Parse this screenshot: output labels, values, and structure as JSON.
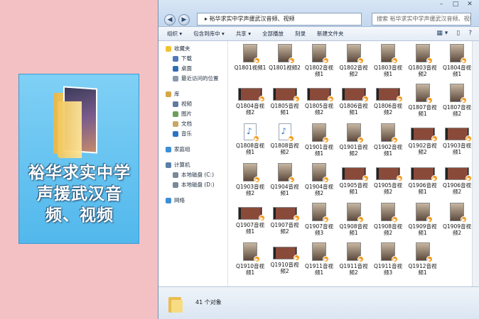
{
  "folder_tile": {
    "caption": "裕华求实中学声援武汉音频、视频"
  },
  "window": {
    "address": "裕华求实中学声援武汉音频、视频",
    "search_placeholder": "搜索 裕华求实中学声援武汉音频、视频",
    "controls": [
      "–",
      "□",
      "✕"
    ]
  },
  "toolbar": {
    "items": [
      "组织 ▾",
      "包含到库中 ▾",
      "共享 ▾",
      "全部播放",
      "刻录",
      "新建文件夹"
    ],
    "right_icons": [
      "▦ ▾",
      "▯",
      "?"
    ]
  },
  "sidebar": {
    "items": [
      {
        "label": "收藏夹",
        "icon": "star-icon",
        "color": "#f2c230",
        "sub": false
      },
      {
        "label": "下载",
        "icon": "download-icon",
        "color": "#4d79b8",
        "sub": true
      },
      {
        "label": "桌面",
        "icon": "desktop-icon",
        "color": "#2f6db2",
        "sub": true
      },
      {
        "label": "最近访问的位置",
        "icon": "recent-icon",
        "color": "#8a9bb0",
        "sub": true
      },
      {
        "label": "",
        "gap": true
      },
      {
        "label": "库",
        "icon": "library-icon",
        "color": "#d7a64a",
        "sub": false
      },
      {
        "label": "视频",
        "icon": "video-icon",
        "color": "#5f7aa0",
        "sub": true
      },
      {
        "label": "图片",
        "icon": "picture-icon",
        "color": "#6a9f5a",
        "sub": true
      },
      {
        "label": "文档",
        "icon": "document-icon",
        "color": "#c9a763",
        "sub": true
      },
      {
        "label": "音乐",
        "icon": "music-icon",
        "color": "#2a74c7",
        "sub": true
      },
      {
        "label": "",
        "gap": true
      },
      {
        "label": "家庭组",
        "icon": "homegroup-icon",
        "color": "#3d8fd6",
        "sub": false
      },
      {
        "label": "",
        "gap": true
      },
      {
        "label": "计算机",
        "icon": "computer-icon",
        "color": "#5a7fa8",
        "sub": false
      },
      {
        "label": "本地磁盘 (C:)",
        "icon": "drive-icon",
        "color": "#7b8899",
        "sub": true
      },
      {
        "label": "本地磁盘 (D:)",
        "icon": "drive-icon",
        "color": "#7b8899",
        "sub": true
      },
      {
        "label": "",
        "gap": true
      },
      {
        "label": "网络",
        "icon": "network-icon",
        "color": "#3d8fd6",
        "sub": false
      }
    ]
  },
  "files": [
    {
      "name": "Q1801视频1",
      "kind": "tall"
    },
    {
      "name": "Q1801视频2",
      "kind": "tall"
    },
    {
      "name": "Q1802音视频1",
      "kind": "tall"
    },
    {
      "name": "Q1802音视频2",
      "kind": "tall"
    },
    {
      "name": "Q1803音视频1",
      "kind": "tall"
    },
    {
      "name": "Q1803音视频2",
      "kind": "tall"
    },
    {
      "name": "Q1804音视频1",
      "kind": "tall"
    },
    {
      "name": "Q1804音视频2",
      "kind": "wide"
    },
    {
      "name": "Q1805音视频1",
      "kind": "wide"
    },
    {
      "name": "Q1805音视频2",
      "kind": "wide"
    },
    {
      "name": "Q1806音视频1",
      "kind": "wide"
    },
    {
      "name": "Q1806音视频2",
      "kind": "wide"
    },
    {
      "name": "Q1807音视频1",
      "kind": "tall"
    },
    {
      "name": "Q1807音视频2",
      "kind": "tall"
    },
    {
      "name": "Q1808音视频1",
      "kind": "audio"
    },
    {
      "name": "Q1808音视频2",
      "kind": "audio"
    },
    {
      "name": "Q1901音视频1",
      "kind": "tall"
    },
    {
      "name": "Q1901音视频2",
      "kind": "tall"
    },
    {
      "name": "Q1902音视频1",
      "kind": "tall"
    },
    {
      "name": "Q1902音视频2",
      "kind": "wide"
    },
    {
      "name": "Q1903音视频1",
      "kind": "wide"
    },
    {
      "name": "Q1903音视频2",
      "kind": "tall"
    },
    {
      "name": "Q1904音视频1",
      "kind": "tall"
    },
    {
      "name": "Q1904音视频2",
      "kind": "tall"
    },
    {
      "name": "Q1905音视频1",
      "kind": "wide"
    },
    {
      "name": "Q1905音视频2",
      "kind": "wide"
    },
    {
      "name": "Q1906音视频1",
      "kind": "wide"
    },
    {
      "name": "Q1906音视频2",
      "kind": "wide"
    },
    {
      "name": "Q1907音视频1",
      "kind": "wide"
    },
    {
      "name": "Q1907音视频2",
      "kind": "wide"
    },
    {
      "name": "Q1907音视频3",
      "kind": "tall"
    },
    {
      "name": "Q1908音视频1",
      "kind": "tall"
    },
    {
      "name": "Q1908音视频2",
      "kind": "tall"
    },
    {
      "name": "Q1909音视频1",
      "kind": "tall"
    },
    {
      "name": "Q1909音视频2",
      "kind": "tall"
    },
    {
      "name": "Q1910音视频1",
      "kind": "tall"
    },
    {
      "name": "Q1910音视频2",
      "kind": "wide"
    },
    {
      "name": "Q1911音视频1",
      "kind": "tall"
    },
    {
      "name": "Q1911音视频2",
      "kind": "tall"
    },
    {
      "name": "Q1911音视频3",
      "kind": "tall"
    },
    {
      "name": "Q1912音视频1",
      "kind": "tall"
    }
  ],
  "status": {
    "count_text": "41 个对象"
  }
}
